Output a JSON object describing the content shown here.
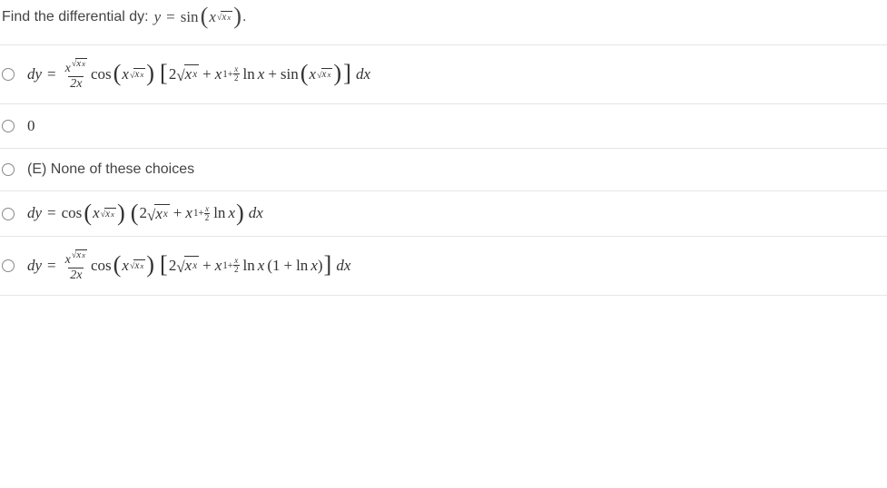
{
  "question": {
    "prompt_text": "Find the differential dy:",
    "y": "y",
    "eq": "=",
    "sin": "sin",
    "x": "x",
    "period": "."
  },
  "sym": {
    "dy": "dy",
    "eq": "=",
    "cos": "cos",
    "sin": "sin",
    "x": "x",
    "ln": "ln",
    "dx": "dx",
    "two": "2",
    "one": "1",
    "plus": "+",
    "surd": "√",
    "lp": "(",
    "rp": ")",
    "lb": "[",
    "rb": "]"
  },
  "choices": {
    "a": {
      "frac_num_prefix": "x",
      "frac_den": "2x"
    },
    "b": {
      "label": "0"
    },
    "c": {
      "label": "(E) None of these choices"
    },
    "d": {},
    "e": {
      "frac_num_prefix": "x",
      "frac_den": "2x",
      "one_plus_ln": "(1 + ln x)"
    }
  }
}
